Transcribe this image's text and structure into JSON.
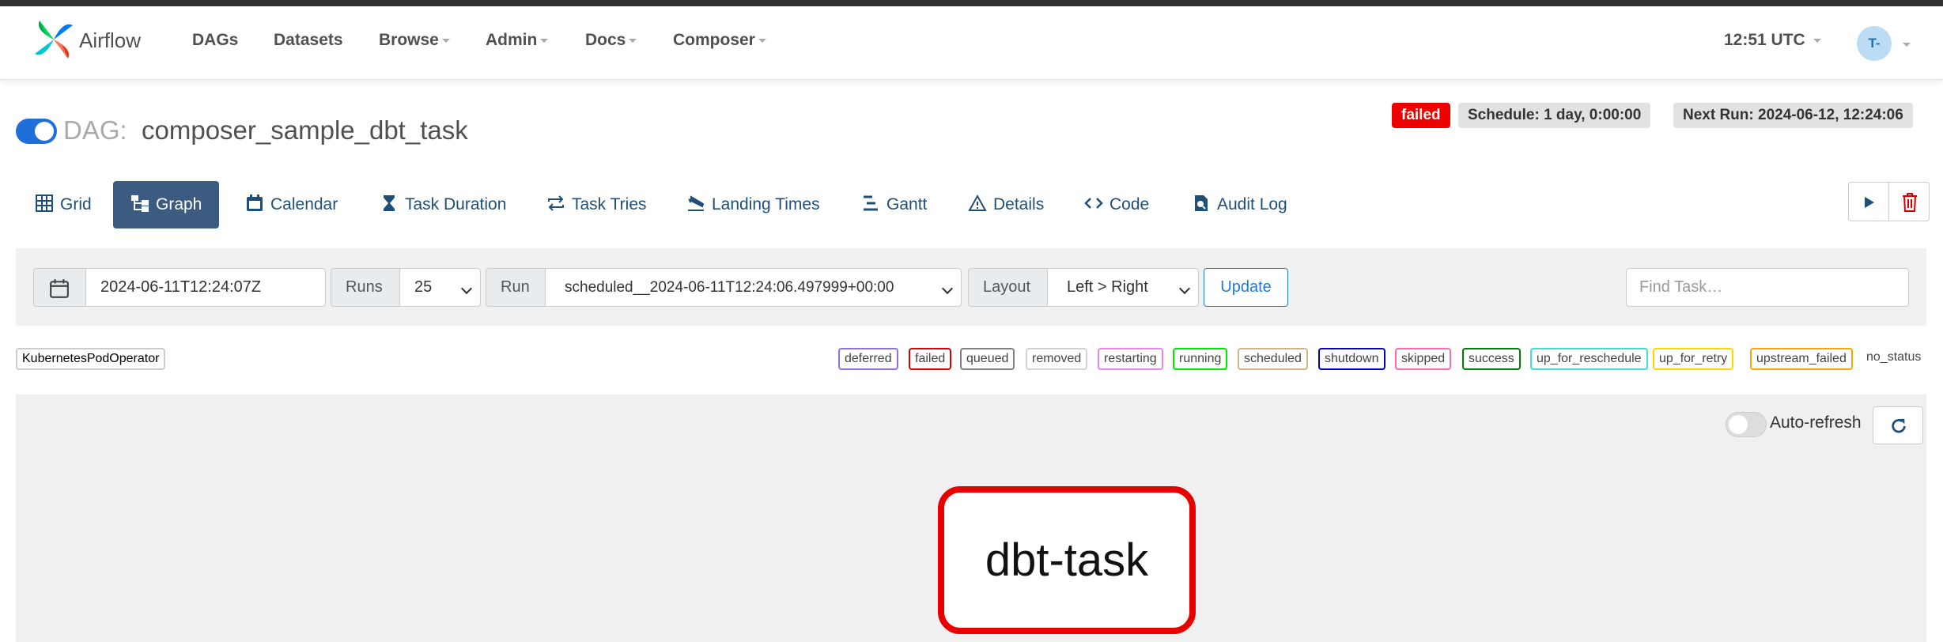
{
  "navbar": {
    "brand": "Airflow",
    "items": [
      {
        "label": "DAGs"
      },
      {
        "label": "Datasets"
      },
      {
        "label": "Browse"
      },
      {
        "label": "Admin"
      },
      {
        "label": "Docs"
      },
      {
        "label": "Composer"
      }
    ],
    "clock": "12:51 UTC",
    "user_initials": "T-"
  },
  "dag": {
    "prefix": "DAG:",
    "name": "composer_sample_dbt_task",
    "status": "failed",
    "schedule": "Schedule: 1 day, 0:00:00",
    "next_run": "Next Run: 2024-06-12, 12:24:06"
  },
  "tabs": [
    {
      "label": "Grid",
      "icon": "grid-icon"
    },
    {
      "label": "Graph",
      "icon": "graph-icon"
    },
    {
      "label": "Calendar",
      "icon": "calendar-icon"
    },
    {
      "label": "Task Duration",
      "icon": "hourglass-icon"
    },
    {
      "label": "Task Tries",
      "icon": "repeat-icon"
    },
    {
      "label": "Landing Times",
      "icon": "plane-landing-icon"
    },
    {
      "label": "Gantt",
      "icon": "gantt-icon"
    },
    {
      "label": "Details",
      "icon": "warning-triangle-icon"
    },
    {
      "label": "Code",
      "icon": "code-icon"
    },
    {
      "label": "Audit Log",
      "icon": "file-search-icon"
    }
  ],
  "filters": {
    "base_date": "2024-06-11T12:24:07Z",
    "runs_label": "Runs",
    "runs_value": "25",
    "run_label": "Run",
    "run_value": "scheduled__2024-06-11T12:24:06.497999+00:00",
    "layout_label": "Layout",
    "layout_value": "Left > Right",
    "update_label": "Update",
    "find_placeholder": "Find Task…"
  },
  "operator_tag": "KubernetesPodOperator",
  "legend": [
    {
      "label": "deferred",
      "color": "#9370db"
    },
    {
      "label": "failed",
      "color": "#e00000"
    },
    {
      "label": "queued",
      "color": "#808080"
    },
    {
      "label": "removed",
      "color": "#d3d3d3"
    },
    {
      "label": "restarting",
      "color": "#ee82ee"
    },
    {
      "label": "running",
      "color": "#00e600"
    },
    {
      "label": "scheduled",
      "color": "#d2b48c"
    },
    {
      "label": "shutdown",
      "color": "#0000cd"
    },
    {
      "label": "skipped",
      "color": "#ff69b4"
    },
    {
      "label": "success",
      "color": "#008000"
    },
    {
      "label": "up_for_reschedule",
      "color": "#40e0d0"
    },
    {
      "label": "up_for_retry",
      "color": "#ffd700"
    },
    {
      "label": "upstream_failed",
      "color": "#ffa500"
    }
  ],
  "no_status": "no_status",
  "graph": {
    "auto_refresh_label": "Auto-refresh",
    "node_label": "dbt-task",
    "node_status_color": "#e60000"
  }
}
